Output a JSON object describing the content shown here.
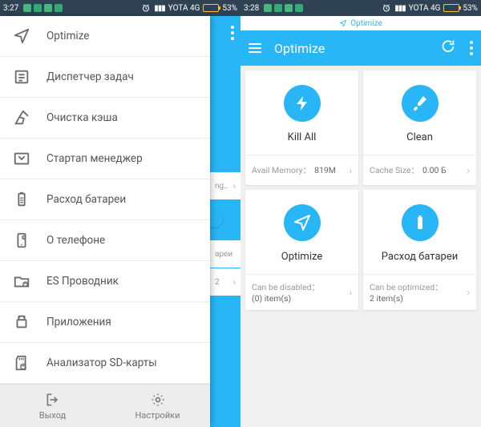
{
  "status": {
    "time_left": "3:27",
    "time_right": "3:28",
    "carrier": "YOTA 4G",
    "signal": "lll",
    "battery_pct": "53%"
  },
  "drawer": {
    "items": [
      {
        "icon": "send",
        "label": "Optimize"
      },
      {
        "icon": "tasks",
        "label": "Диспетчер задач"
      },
      {
        "icon": "broom",
        "label": "Очистка кэша"
      },
      {
        "icon": "startup",
        "label": "Стартап менеджер"
      },
      {
        "icon": "battery",
        "label": "Расход батареи"
      },
      {
        "icon": "about",
        "label": "О телефоне"
      },
      {
        "icon": "esfile",
        "label": "ES Проводник"
      },
      {
        "icon": "apps",
        "label": "Приложения"
      },
      {
        "icon": "sdcard",
        "label": "Анализатор SD-карты"
      }
    ],
    "footer": {
      "exit": "Выход",
      "settings": "Настройки"
    },
    "peek": {
      "p1": "ng..",
      "p2": "ареи",
      "p3_label": "2"
    }
  },
  "right": {
    "optimize_tag": "Optimize",
    "appbar_title": "Optimize",
    "tiles": [
      {
        "icon": "bolt",
        "title": "Kill All",
        "sub_label": "Avail Memory：",
        "sub_value": "819M"
      },
      {
        "icon": "brush",
        "title": "Clean",
        "sub_label": "Cache Size：",
        "sub_value": "0.00 Б"
      },
      {
        "icon": "send",
        "title": "Optimize",
        "sub_label": "Can be disabled：",
        "sub_value": "(0) item(s)"
      },
      {
        "icon": "battery",
        "title": "Расход батареи",
        "sub_label": "Can be optimized：",
        "sub_value": "2 item(s)"
      }
    ]
  }
}
